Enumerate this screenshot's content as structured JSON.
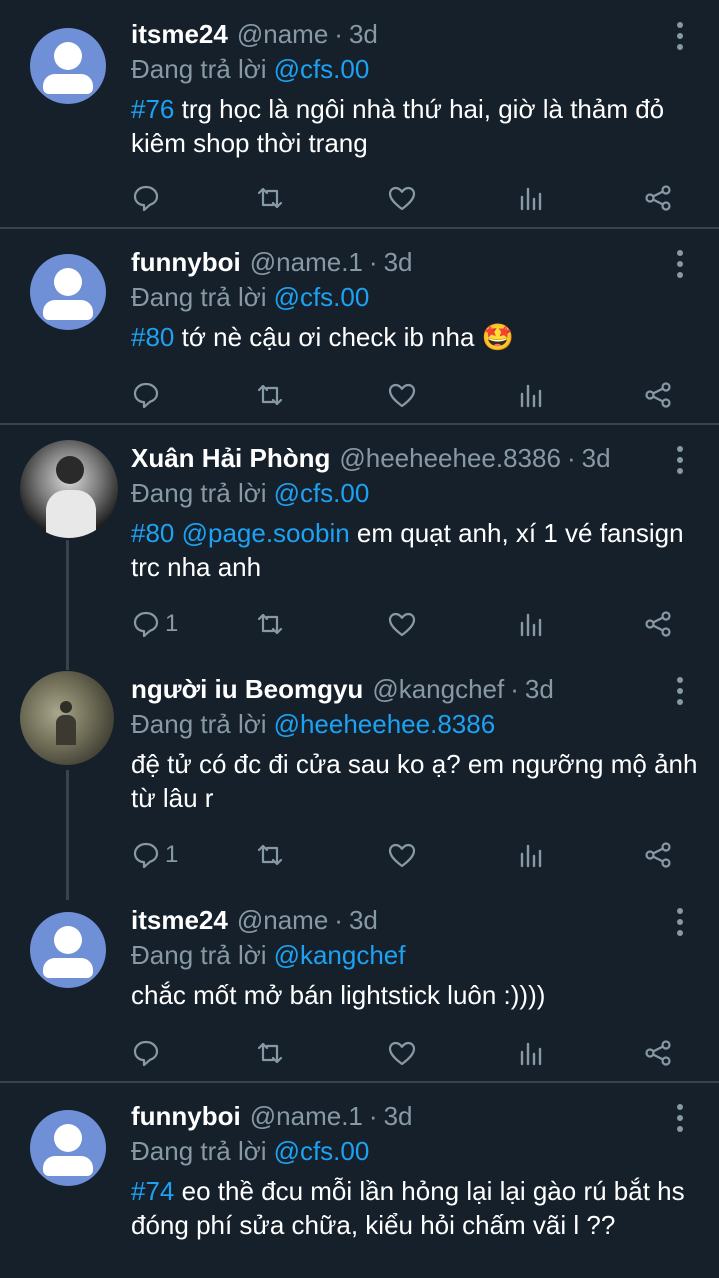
{
  "reply_prefix": "Đang trả lời",
  "tweets": [
    {
      "name": "itsme24",
      "handle": "@name",
      "separator": "·",
      "time": "3d",
      "reply_to": "@cfs.00",
      "tag": "#76",
      "text": " trg học là ngôi nhà thứ hai, giờ là thảm đỏ kiêm shop thời trang",
      "reply_count": ""
    },
    {
      "name": "funnyboi",
      "handle": "@name.1",
      "separator": "·",
      "time": "3d",
      "reply_to": "@cfs.00",
      "tag": "#80",
      "text": " tớ nè cậu ơi check ib nha 🤩",
      "reply_count": ""
    },
    {
      "name": "Xuân Hải Phòng",
      "handle": "@heeheehee.8386",
      "separator": "·",
      "time": "3d",
      "reply_to": "@cfs.00",
      "tag": "#80 @page.soobin",
      "text": " em quạt anh, xí 1 vé fansign trc nha anh",
      "reply_count": "1"
    },
    {
      "name": "người iu Beomgyu",
      "handle": "@kangchef",
      "separator": "·",
      "time": "3d",
      "reply_to": "@heeheehee.8386",
      "tag": "",
      "text": "đệ tử có đc đi cửa sau ko ạ? em ngưỡng mộ ảnh từ lâu r",
      "reply_count": "1"
    },
    {
      "name": "itsme24",
      "handle": "@name",
      "separator": "·",
      "time": "3d",
      "reply_to": "@kangchef",
      "tag": "",
      "text": "chắc mốt mở bán lightstick luôn :))))",
      "reply_count": ""
    },
    {
      "name": "funnyboi",
      "handle": "@name.1",
      "separator": "·",
      "time": "3d",
      "reply_to": "@cfs.00",
      "tag": "#74",
      "text": " eo thề đcu mỗi lần hỏng lại lại gào rú bắt hs đóng phí sửa chữa, kiểu hỏi chấm vãi l ??",
      "reply_count": ""
    }
  ],
  "colors": {
    "background": "#15202b",
    "accent": "#1da1f2",
    "muted": "#8899a6",
    "divider": "#38444d"
  },
  "icons": [
    "reply-icon",
    "retweet-icon",
    "like-icon",
    "analytics-icon",
    "share-icon",
    "more-icon"
  ]
}
